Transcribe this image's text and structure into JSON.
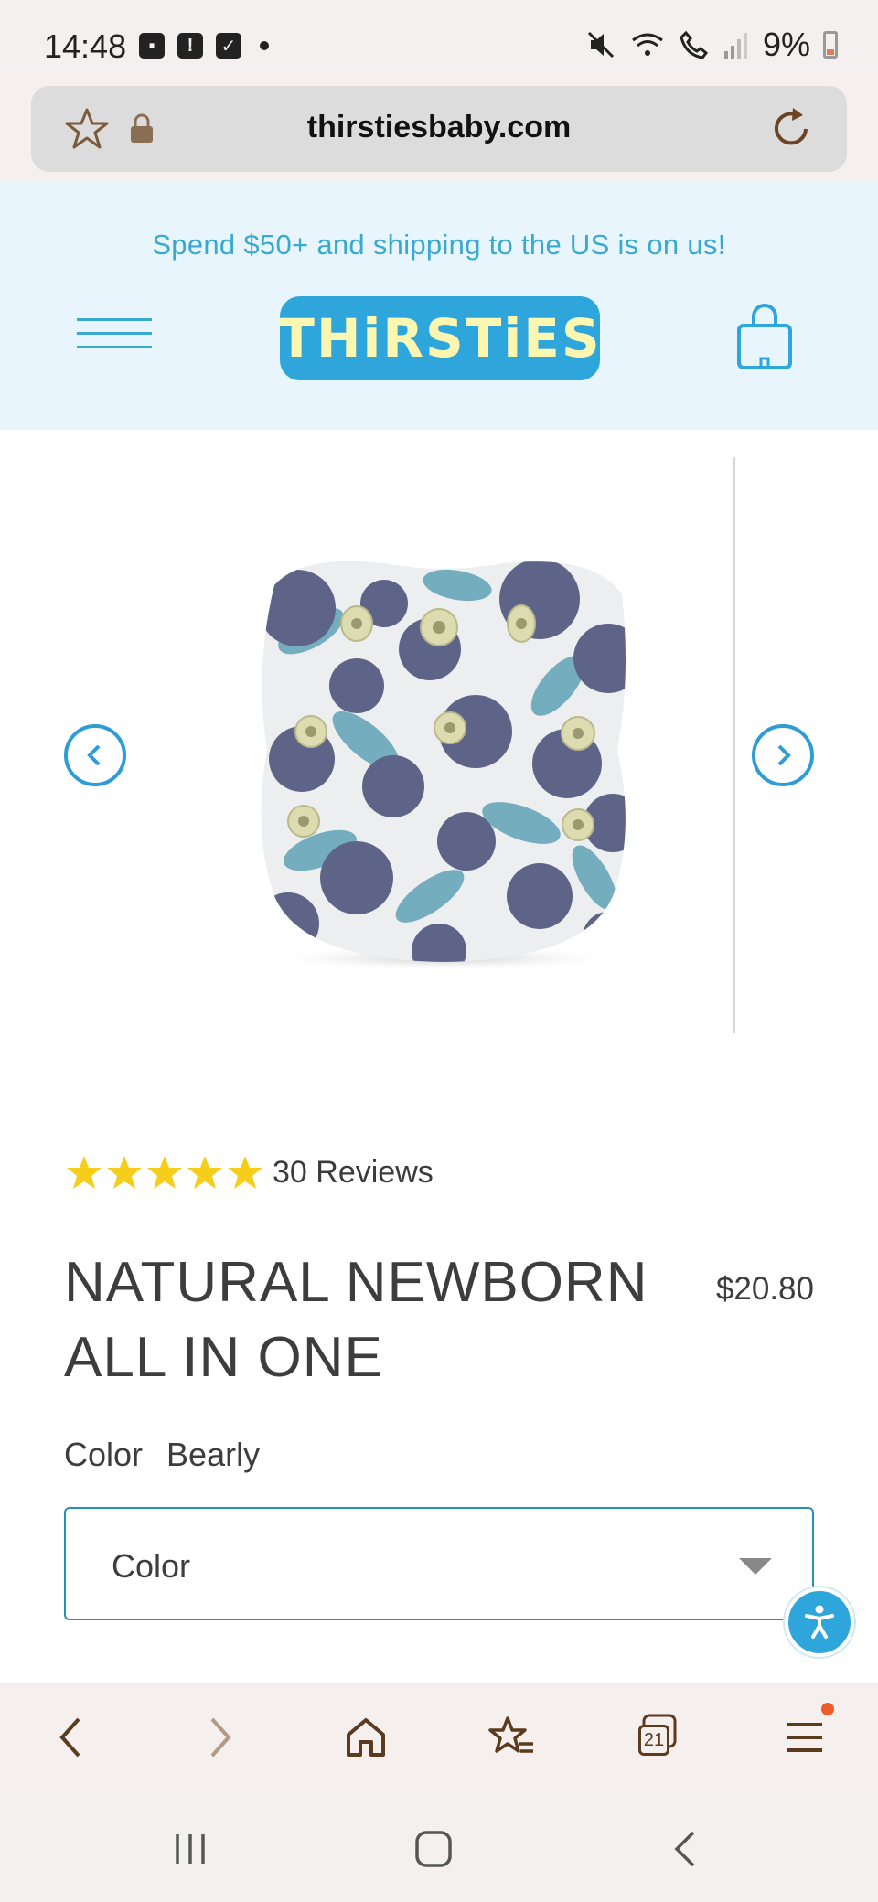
{
  "status_bar": {
    "time": "14:48",
    "battery": "9%",
    "left_icons": [
      "image-icon",
      "alert-icon",
      "check-icon",
      "dot-icon"
    ],
    "right_icons": [
      "mute-icon",
      "wifi-icon",
      "wifi-call-icon",
      "signal-icon",
      "battery-icon"
    ]
  },
  "browser": {
    "url": "thirstiesbaby.com",
    "tab_count": "21",
    "toolbar": [
      "back-icon",
      "forward-icon",
      "home-icon",
      "bookmarks-icon",
      "tabs-icon",
      "menu-icon"
    ]
  },
  "header": {
    "promo": "Spend $50+ and shipping to the US is on us!",
    "logo": "THiRSTiES"
  },
  "product": {
    "rating": 5,
    "reviews": "30 Reviews",
    "title_line1": "NATURAL NEWBORN",
    "title_line2": "ALL IN ONE",
    "price": "$20.80",
    "color_label": "Color",
    "color_value": "Bearly",
    "select_placeholder": "Color"
  },
  "colors": {
    "accent": "#2ea6db",
    "promo_text": "#3aa9cf",
    "header_bg": "#e8f5fc",
    "star": "#f7cd1c",
    "browser_icon": "#5a3b1e"
  }
}
